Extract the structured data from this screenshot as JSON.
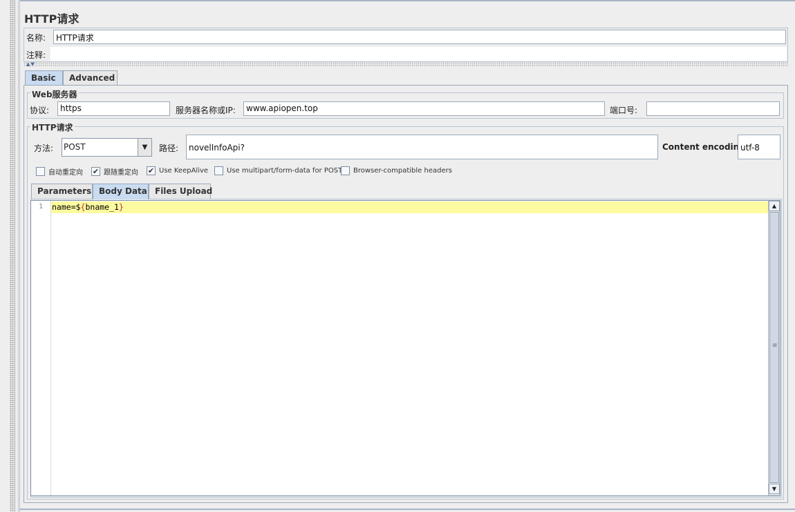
{
  "panel": {
    "title": "HTTP请求"
  },
  "meta": {
    "name_label": "名称:",
    "name_value": "HTTP请求",
    "comment_label": "注释:",
    "comment_value": ""
  },
  "tabs": [
    {
      "label": "Basic",
      "active": true
    },
    {
      "label": "Advanced",
      "active": false
    }
  ],
  "web_server": {
    "group_title": "Web服务器",
    "protocol_label": "协议:",
    "protocol_value": "https",
    "server_label": "服务器名称或IP:",
    "server_value": "www.apiopen.top",
    "port_label": "端口号:",
    "port_value": ""
  },
  "http_request": {
    "group_title": "HTTP请求",
    "method_label": "方法:",
    "method_value": "POST",
    "path_label": "路径:",
    "path_value": "novelInfoApi?",
    "encoding_label": "Content encoding:",
    "encoding_value": "utf-8"
  },
  "options": [
    {
      "label": "自动重定向",
      "checked": false
    },
    {
      "label": "跟随重定向",
      "checked": true
    },
    {
      "label": "Use KeepAlive",
      "checked": true
    },
    {
      "label": "Use multipart/form-data for POST",
      "checked": false
    },
    {
      "label": "Browser-compatible headers",
      "checked": false
    }
  ],
  "subtabs": [
    {
      "label": "Parameters",
      "active": false
    },
    {
      "label": "Body Data",
      "active": true
    },
    {
      "label": "Files Upload",
      "active": false
    }
  ],
  "editor": {
    "line_number": "1",
    "code_prefix": "name=$",
    "code_open": "{",
    "code_var": "bname_1",
    "code_close": "}"
  }
}
